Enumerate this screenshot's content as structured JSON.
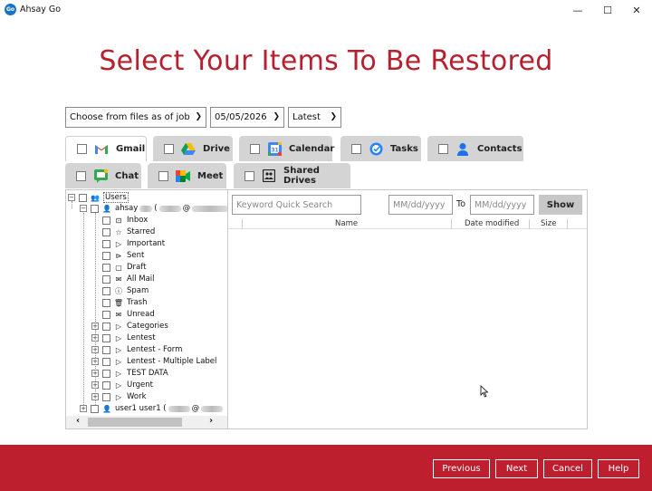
{
  "app": {
    "title": "Ahsay Go",
    "logo_text": "Go"
  },
  "window_controls": {
    "minimize": "—",
    "maximize": "☐",
    "close": "✕"
  },
  "page_title": "Select Your Items To Be Restored",
  "filters": {
    "job_mode": "Choose from files as of job",
    "date": "05/05/2026",
    "version": "Latest"
  },
  "tabs": [
    {
      "label": "Gmail",
      "icon": "gmail-icon",
      "active": true
    },
    {
      "label": "Drive",
      "icon": "drive-icon"
    },
    {
      "label": "Calendar",
      "icon": "calendar-icon"
    },
    {
      "label": "Tasks",
      "icon": "tasks-icon"
    },
    {
      "label": "Contacts",
      "icon": "contacts-icon"
    },
    {
      "label": "Chat",
      "icon": "chat-icon"
    },
    {
      "label": "Meet",
      "icon": "meet-icon"
    },
    {
      "label": "Shared Drives",
      "icon": "shared-drives-icon"
    }
  ],
  "tree": {
    "root": "Users",
    "user1_prefix": "ahsay",
    "user1_at": "(",
    "user1_at2": "@",
    "folders": [
      {
        "label": "Inbox",
        "icon": "⊡"
      },
      {
        "label": "Starred",
        "icon": "☆"
      },
      {
        "label": "Important",
        "icon": "▷"
      },
      {
        "label": "Sent",
        "icon": "⊳"
      },
      {
        "label": "Draft",
        "icon": "▢"
      },
      {
        "label": "All Mail",
        "icon": "✉"
      },
      {
        "label": "Spam",
        "icon": "ⓘ"
      },
      {
        "label": "Trash",
        "icon": "🗑"
      },
      {
        "label": "Unread",
        "icon": "✉"
      }
    ],
    "labels": [
      "Categories",
      "Lentest",
      "Lentest - Form",
      "Lentest - Multiple Label",
      "TEST DATA",
      "Urgent",
      "Work"
    ],
    "user2": "user1 user1 ("
  },
  "search": {
    "keyword_placeholder": "Keyword Quick Search",
    "date_from_placeholder": "MM/dd/yyyy",
    "to_label": "To",
    "date_to_placeholder": "MM/dd/yyyy",
    "show_label": "Show"
  },
  "columns": {
    "name": "Name",
    "date_modified": "Date modified",
    "size": "Size"
  },
  "footer": {
    "previous": "Previous",
    "next": "Next",
    "cancel": "Cancel",
    "help": "Help"
  },
  "colors": {
    "brand": "#bd1f2f",
    "title": "#b7212f"
  }
}
